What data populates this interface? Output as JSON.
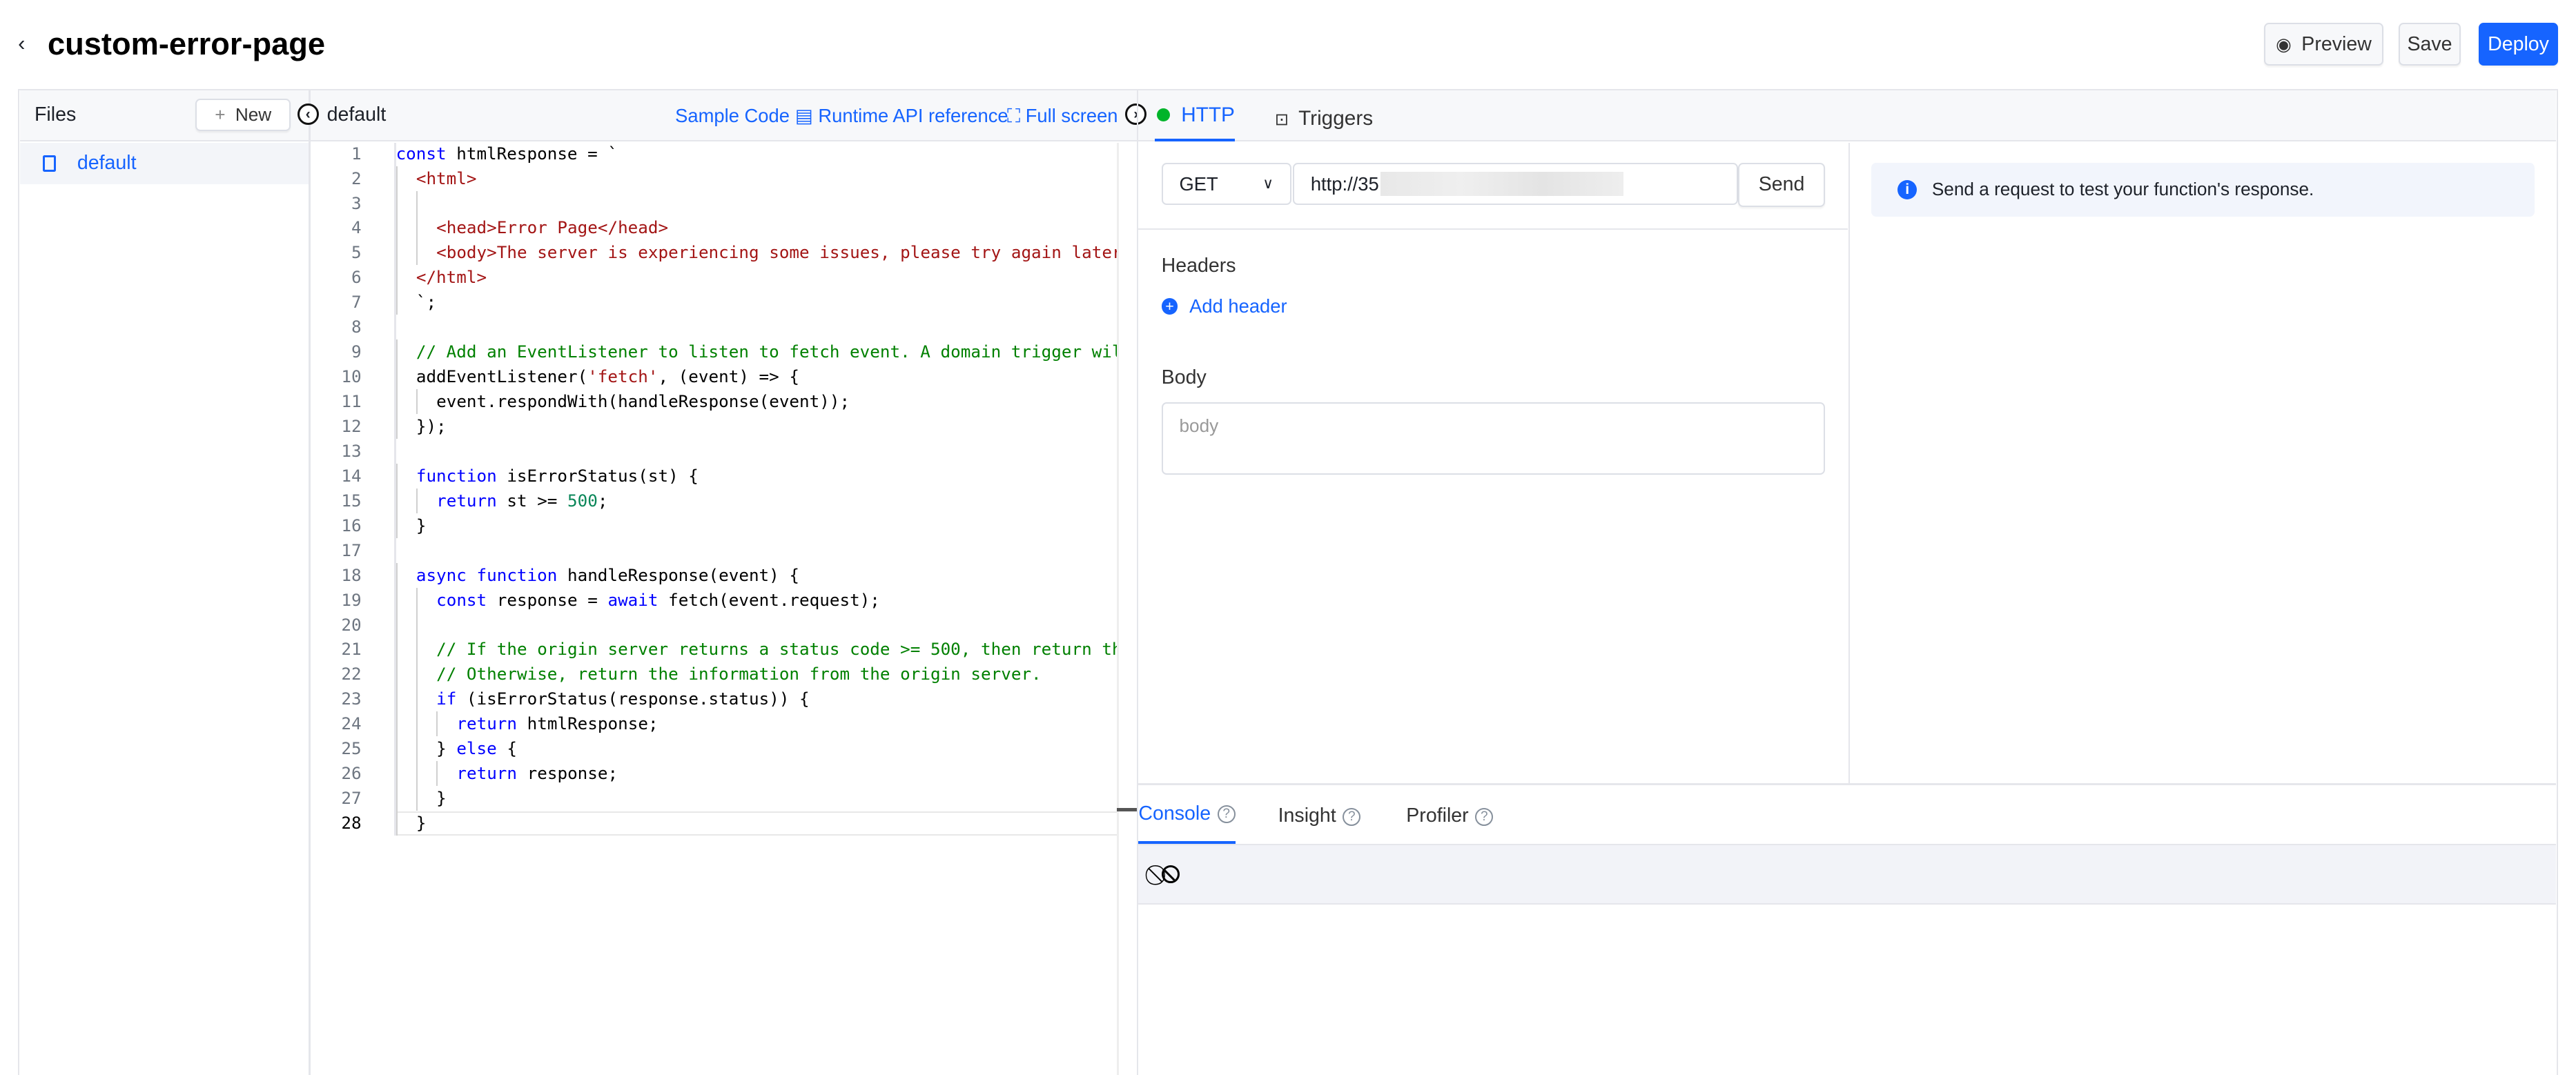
{
  "header": {
    "title": "custom-error-page",
    "preview": "Preview",
    "save": "Save",
    "deploy": "Deploy"
  },
  "files": {
    "title": "Files",
    "new_label": "New",
    "items": [
      {
        "label": "default"
      }
    ]
  },
  "editor": {
    "tab": "default",
    "sample_code": "Sample Code",
    "runtime_api": "Runtime API reference",
    "full_screen": "Full screen",
    "lines": [
      {
        "n": "1",
        "i": 0,
        "t": [
          [
            "kw",
            "const"
          ],
          [
            "tx",
            " htmlResponse = `"
          ]
        ]
      },
      {
        "n": "2",
        "i": 1,
        "t": [
          [
            "str",
            "<html>"
          ]
        ]
      },
      {
        "n": "3",
        "i": 2,
        "t": []
      },
      {
        "n": "4",
        "i": 2,
        "t": [
          [
            "str",
            "<head>Error Page</head>"
          ]
        ]
      },
      {
        "n": "5",
        "i": 2,
        "t": [
          [
            "str",
            "<body>The server is experiencing some issues, please try again later</b"
          ]
        ]
      },
      {
        "n": "6",
        "i": 1,
        "t": [
          [
            "str",
            "</html>"
          ]
        ]
      },
      {
        "n": "7",
        "i": 1,
        "t": [
          [
            "tx",
            "`;"
          ]
        ]
      },
      {
        "n": "8",
        "i": 0,
        "t": []
      },
      {
        "n": "9",
        "i": 1,
        "t": [
          [
            "cm",
            "// Add an EventListener to listen to fetch event. A domain trigger will t"
          ]
        ]
      },
      {
        "n": "10",
        "i": 1,
        "t": [
          [
            "tx",
            "addEventListener("
          ],
          [
            "str",
            "'fetch'"
          ],
          [
            "tx",
            ", (event) => {"
          ]
        ]
      },
      {
        "n": "11",
        "i": 2,
        "t": [
          [
            "tx",
            "event.respondWith(handleResponse(event));"
          ]
        ]
      },
      {
        "n": "12",
        "i": 1,
        "t": [
          [
            "tx",
            "});"
          ]
        ]
      },
      {
        "n": "13",
        "i": 0,
        "t": []
      },
      {
        "n": "14",
        "i": 1,
        "t": [
          [
            "kw",
            "function"
          ],
          [
            "tx",
            " isErrorStatus(st) {"
          ]
        ]
      },
      {
        "n": "15",
        "i": 2,
        "t": [
          [
            "kw",
            "return"
          ],
          [
            "tx",
            " st >= "
          ],
          [
            "num",
            "500"
          ],
          [
            "tx",
            ";"
          ]
        ]
      },
      {
        "n": "16",
        "i": 1,
        "t": [
          [
            "tx",
            "}"
          ]
        ]
      },
      {
        "n": "17",
        "i": 0,
        "t": []
      },
      {
        "n": "18",
        "i": 1,
        "t": [
          [
            "kw",
            "async function"
          ],
          [
            "tx",
            " handleResponse(event) {"
          ]
        ]
      },
      {
        "n": "19",
        "i": 2,
        "t": [
          [
            "kw",
            "const"
          ],
          [
            "tx",
            " response = "
          ],
          [
            "kw",
            "await"
          ],
          [
            "tx",
            " fetch(event.request);"
          ]
        ]
      },
      {
        "n": "20",
        "i": 2,
        "t": []
      },
      {
        "n": "21",
        "i": 2,
        "t": [
          [
            "cm",
            "// If the origin server returns a status code >= 500, then return the c"
          ]
        ]
      },
      {
        "n": "22",
        "i": 2,
        "t": [
          [
            "cm",
            "// Otherwise, return the information from the origin server."
          ]
        ]
      },
      {
        "n": "23",
        "i": 2,
        "t": [
          [
            "kw",
            "if"
          ],
          [
            "tx",
            " (isErrorStatus(response.status)) {"
          ]
        ]
      },
      {
        "n": "24",
        "i": 3,
        "t": [
          [
            "kw",
            "return"
          ],
          [
            "tx",
            " htmlResponse;"
          ]
        ]
      },
      {
        "n": "25",
        "i": 2,
        "t": [
          [
            "tx",
            "} "
          ],
          [
            "kw",
            "else"
          ],
          [
            "tx",
            " {"
          ]
        ]
      },
      {
        "n": "26",
        "i": 3,
        "t": [
          [
            "kw",
            "return"
          ],
          [
            "tx",
            " response;"
          ]
        ]
      },
      {
        "n": "27",
        "i": 2,
        "t": [
          [
            "tx",
            "}"
          ]
        ]
      },
      {
        "n": "28",
        "i": 1,
        "t": [
          [
            "tx",
            "}"
          ]
        ]
      }
    ]
  },
  "right": {
    "tabs": [
      {
        "label": "HTTP",
        "active": true
      },
      {
        "label": "Triggers"
      }
    ],
    "method": "GET",
    "url": "http://35",
    "send": "Send",
    "headers_label": "Headers",
    "add_header": "Add header",
    "body_label": "Body",
    "body_placeholder": "body",
    "info": "Send a request to test your function's response."
  },
  "bottom": {
    "tabs": [
      {
        "label": "Console"
      },
      {
        "label": "Insight"
      },
      {
        "label": "Profiler"
      }
    ]
  },
  "colors": {
    "accent": "#1664ff",
    "status_ok": "#00b42a"
  }
}
